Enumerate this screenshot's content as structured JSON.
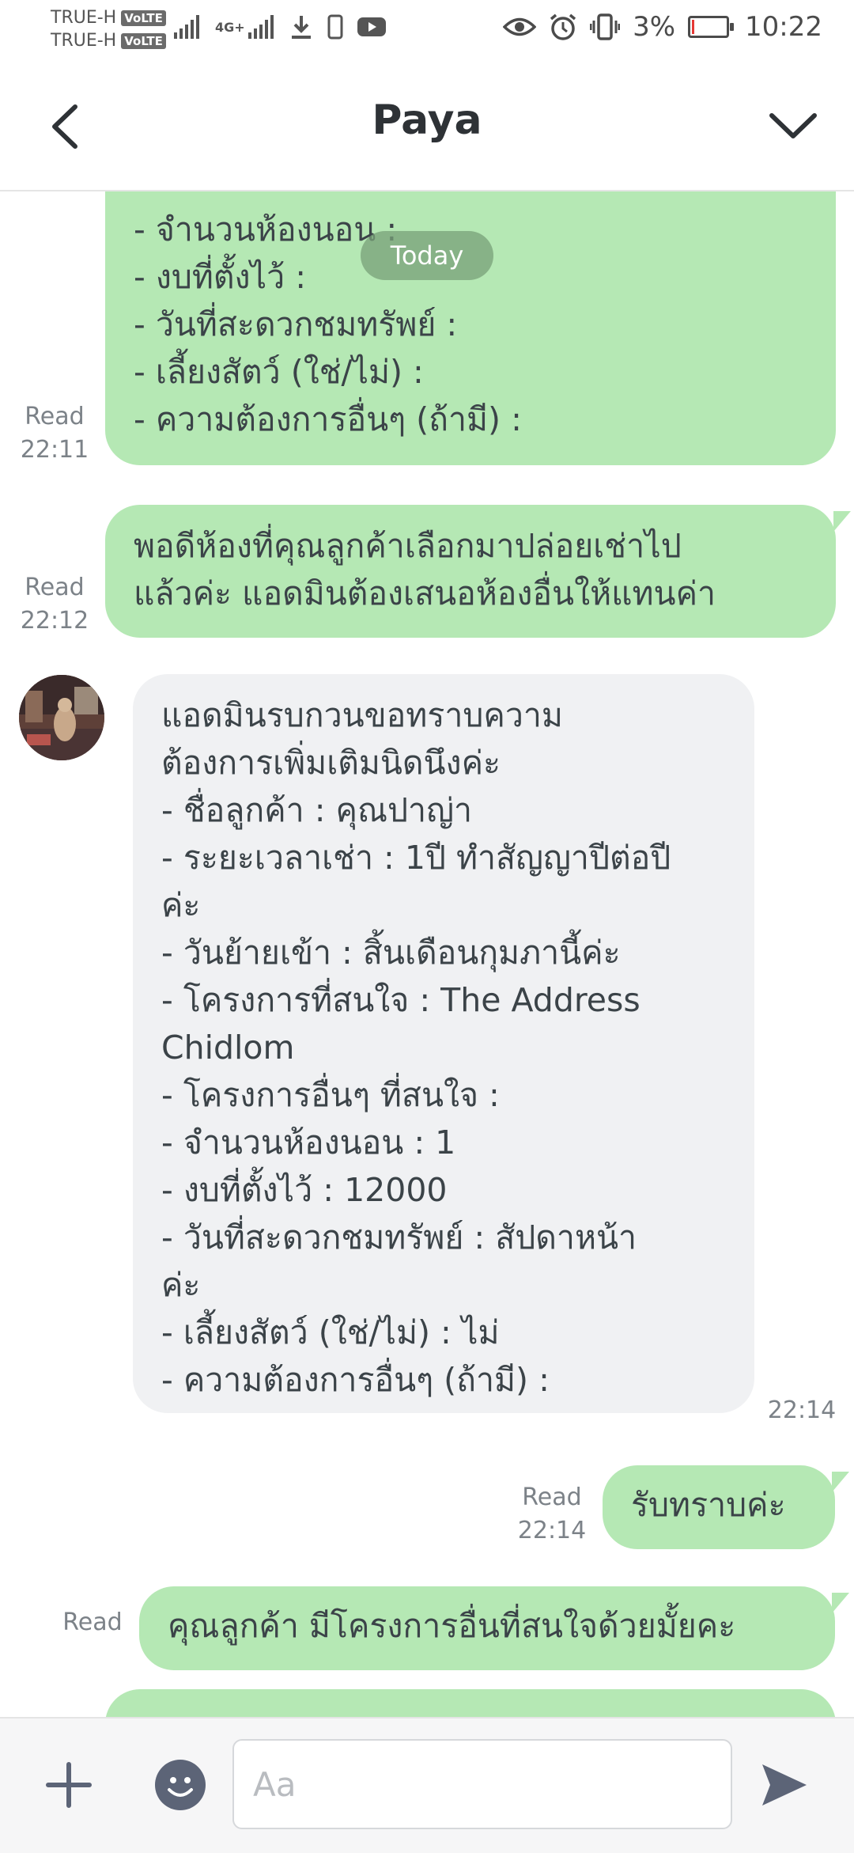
{
  "status_bar": {
    "carrier1": "TRUE-H",
    "carrier2": "TRUE-H",
    "volte": "VoLTE",
    "network": "4G+",
    "battery_percent": "3%",
    "time": "10:22",
    "battery_level": 0.03
  },
  "header": {
    "title": "Paya"
  },
  "chat": {
    "date_separator": "Today",
    "messages": [
      {
        "lines": [
          "- จำนวนห้องนอน :",
          "- งบที่ตั้งไว้ :",
          "- วันที่สะดวกชมทรัพย์ :",
          "- เลี้ยงสัตว์ (ใช่/ไม่) :",
          "- ความต้องการอื่นๆ (ถ้ามี) :"
        ],
        "read": "Read",
        "time": "22:11"
      },
      {
        "lines": [
          "พอดีห้องที่คุณลูกค้าเลือกมาปล่อยเช่าไป",
          "แล้วค่ะ แอดมินต้องเสนอห้องอื่นให้แทนค่า"
        ],
        "read": "Read",
        "time": "22:12"
      },
      {
        "lines": [
          "แอดมินรบกวนขอทราบความ",
          "ต้องการเพิ่มเติมนิดนึงค่ะ",
          "- ชื่อลูกค้า : คุณปาญ่า",
          "- ระยะเวลาเช่า : 1ปี ทำสัญญาปีต่อปี",
          "ค่ะ",
          "- วันย้ายเข้า : สิ้นเดือนกุมภานี้ค่ะ",
          "- โครงการที่สนใจ : The Address",
          "Chidlom",
          "- โครงการอื่นๆ ที่สนใจ :",
          "- จำนวนห้องนอน : 1",
          "- งบที่ตั้งไว้ : 12000",
          "- วันที่สะดวกชมทรัพย์ : สัปดาหน้า",
          "ค่ะ",
          "- เลี้ยงสัตว์ (ใช่/ไม่) : ไม่",
          "- ความต้องการอื่นๆ (ถ้ามี) :"
        ],
        "time": "22:14"
      },
      {
        "text": "รับทราบค่ะ",
        "read": "Read",
        "time": "22:14"
      },
      {
        "text": "คุณลูกค้า มีโครงการอื่นที่สนใจด้วยมั้ยคะ",
        "read": "Read"
      }
    ]
  },
  "input": {
    "placeholder": "Aa"
  }
}
